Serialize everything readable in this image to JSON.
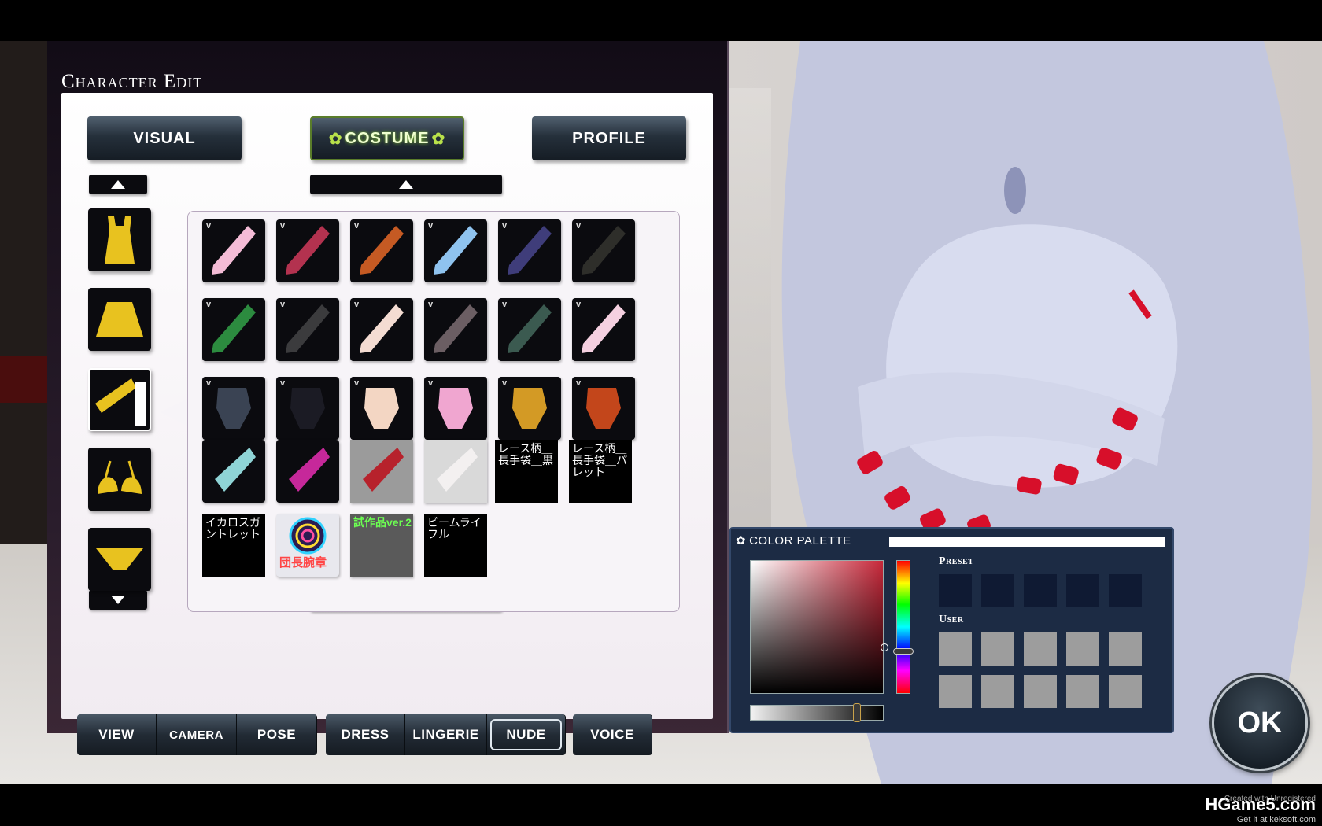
{
  "panel": {
    "title": "Character Edit"
  },
  "tabs": {
    "visual": "VISUAL",
    "costume": "COSTUME",
    "profile": "PROFILE"
  },
  "categories": [
    {
      "name": "top",
      "color": "#e8c21f"
    },
    {
      "name": "skirt",
      "color": "#e8c21f"
    },
    {
      "name": "gloves",
      "color": "#e8c21f"
    },
    {
      "name": "bra",
      "color": "#e8c21f"
    },
    {
      "name": "panties",
      "color": "#e8c21f"
    }
  ],
  "items": {
    "row1": [
      "#f4bcd6",
      "#b3324f",
      "#c55a23",
      "#8fc3ef",
      "#3f3d7a",
      "#2e2e2a"
    ],
    "row2": [
      "#2c8b3f",
      "#3b3b3d",
      "#f4dcd2",
      "#6b5e63",
      "#3b5a50",
      "#f5d0e0"
    ],
    "row3": [
      "#3a4353",
      "#1b1b24",
      "#f3d6c3",
      "#f0a6d0",
      "#d39a25",
      "#c3461b"
    ],
    "row4_labels": [
      "レース柄＿長手袋＿黒",
      "レース柄＿長手袋＿パレット"
    ],
    "row5_labels": [
      "イカロスガントレット",
      "団長腕章",
      "試作品ver.2",
      "ビームライフル"
    ]
  },
  "nav": {
    "view": "VIEW",
    "camera": "CAMERA",
    "pose": "POSE",
    "dress": "DRESS",
    "lingerie": "LINGERIE",
    "nude": "NUDE",
    "voice": "VOICE"
  },
  "palette": {
    "title": "COLOR PALETTE",
    "preset_label": "Preset",
    "user_label": "User",
    "preset_color": "#0f1a33",
    "user_color": "#9d9d9d",
    "hue_color": "#c8283a"
  },
  "ok_button": "OK",
  "watermark": {
    "main": "HGame5.com",
    "sub": "Get it at keksoft.com",
    "reg": "Created with Unregistered"
  }
}
